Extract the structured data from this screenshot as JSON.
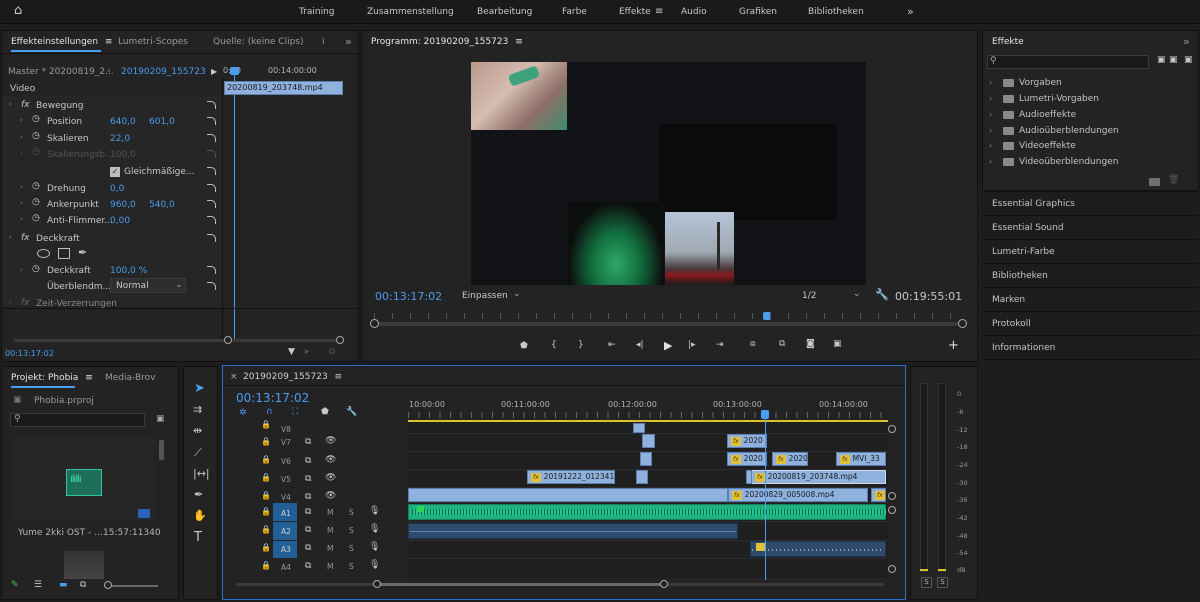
{
  "workspaces": {
    "items": [
      "Training",
      "Zusammenstellung",
      "Bearbeitung",
      "Farbe",
      "Effekte",
      "Audio",
      "Grafiken",
      "Bibliotheken"
    ],
    "active": "Effekte",
    "more": "»"
  },
  "effect_controls": {
    "tabs": [
      "Effekteinstellungen",
      "Lumetri-Scopes",
      "Quelle: (keine Clips)",
      "i"
    ],
    "master": "Master * 20200819_2...",
    "seq": "20190209_155723",
    "mini_time_start": "0:00",
    "mini_time": "00:14:00:00",
    "mini_clip": "20200819_203748.mp4",
    "video_label": "Video",
    "motion": {
      "label": "Bewegung",
      "position": {
        "label": "Position",
        "x": "640,0",
        "y": "601,0"
      },
      "scale": {
        "label": "Skalieren",
        "v": "22,0"
      },
      "scale_width": {
        "label": "Skalierungsb...",
        "v": "100,0"
      },
      "uniform": "Gleichmäßige...",
      "rotation": {
        "label": "Drehung",
        "v": "0,0"
      },
      "anchor": {
        "label": "Ankerpunkt",
        "x": "960,0",
        "y": "540,0"
      },
      "antiflicker": {
        "label": "Anti-Flimmer...",
        "v": "0,00"
      }
    },
    "opacity": {
      "label": "Deckkraft",
      "value_label": "Deckkraft",
      "v": "100,0 %",
      "blend_label": "Überblendm...",
      "blend": "Normal"
    },
    "time_remap": "Zeit-Verzerrungen",
    "timecode": "00:13:17:02"
  },
  "program": {
    "title": "Programm: 20190209_155723",
    "timecode": "00:13:17:02",
    "fit": "Einpassen",
    "quality": "1/2",
    "duration": "00:19:55:01",
    "play_position": 0.665
  },
  "effects_panel": {
    "title": "Effekte",
    "folders": [
      "Vorgaben",
      "Lumetri-Vorgaben",
      "Audioeffekte",
      "Audioüberblendungen",
      "Videoeffekte",
      "Videoüberblendungen"
    ],
    "sections": [
      "Essential Graphics",
      "Essential Sound",
      "Lumetri-Farbe",
      "Bibliotheken",
      "Marken",
      "Protokoll",
      "Informationen"
    ]
  },
  "project": {
    "tabs": [
      "Projekt: Phobia",
      "Media-Brov"
    ],
    "file": "Phobia.prproj",
    "item_name": "Yume 2kki OST - ...",
    "item_dur": "15:57:11340"
  },
  "timeline": {
    "tab": "20190209_155723",
    "timecode": "00:13:17:02",
    "ruler": [
      "10:00:00",
      "00:11:00:00",
      "00:12:00:00",
      "00:13:00:00",
      "00:14:00:00"
    ],
    "video_tracks": [
      "V8",
      "V7",
      "V6",
      "V5",
      "V4"
    ],
    "audio_tracks": [
      "A1",
      "A2",
      "A3",
      "A4"
    ],
    "m": "M",
    "s": "S",
    "clips": {
      "v7": "2020",
      "v6a": "2020",
      "v6b": "2020",
      "v6c": "MVI_33",
      "v5a": "20191222_012341.",
      "v5b": "20200819_203748.mp4",
      "v4": "20200829_005008.mp4"
    }
  },
  "meter": {
    "scale": [
      "0",
      "-6",
      "-12",
      "-18",
      "-24",
      "-30",
      "-36",
      "-42",
      "-48",
      "-54",
      "dB"
    ],
    "solo": [
      "S",
      "S"
    ]
  }
}
